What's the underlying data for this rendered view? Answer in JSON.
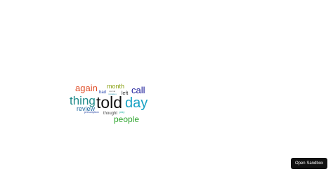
{
  "word_cloud": {
    "words": [
      {
        "text": "told",
        "color": "#111111"
      },
      {
        "text": "thing",
        "color": "#1f8a8a"
      },
      {
        "text": "day",
        "color": "#17a2c4"
      },
      {
        "text": "again",
        "color": "#e0502a"
      },
      {
        "text": "call",
        "color": "#1a1a9a"
      },
      {
        "text": "people",
        "color": "#2ea52e"
      },
      {
        "text": "month",
        "color": "#88a010"
      },
      {
        "text": "review",
        "color": "#1f6aa0"
      },
      {
        "text": "left",
        "color": "#333333"
      },
      {
        "text": "bad",
        "color": "#2a4ab0"
      },
      {
        "text": "thought",
        "color": "#444444"
      },
      {
        "text": "prescription",
        "color": "#1a3aa0"
      },
      {
        "text": "play",
        "color": "#1ab0a0"
      },
      {
        "text": "normal",
        "color": "#666666"
      },
      {
        "text": "mistakes",
        "color": "#3a9ab0"
      }
    ]
  },
  "sandbox_button": {
    "label": "Open Sandbox"
  }
}
